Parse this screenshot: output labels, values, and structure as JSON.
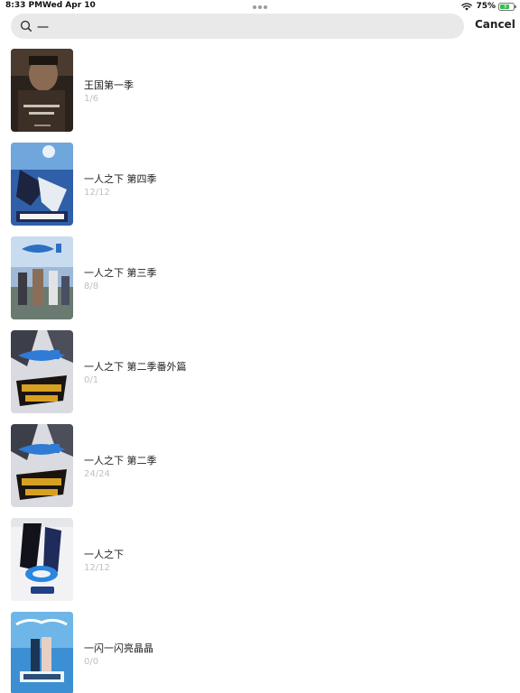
{
  "status_bar": {
    "time": "8:33 PM",
    "date": "Wed Apr 10",
    "battery_percent": "75%",
    "battery_level": 0.75,
    "wifi_icon": "wifi-icon",
    "battery_icon": "battery-charging-icon"
  },
  "search": {
    "value": "一",
    "icon": "search-icon"
  },
  "cancel_label": "Cancel",
  "results": [
    {
      "title": "王国第一季",
      "progress": "1/6"
    },
    {
      "title": "一人之下 第四季",
      "progress": "12/12"
    },
    {
      "title": "一人之下 第三季",
      "progress": "8/8"
    },
    {
      "title": "一人之下 第二季番外篇",
      "progress": "0/1"
    },
    {
      "title": "一人之下 第二季",
      "progress": "24/24"
    },
    {
      "title": "一人之下",
      "progress": "12/12"
    },
    {
      "title": "一闪一闪亮晶晶",
      "progress": "0/0"
    }
  ],
  "colors": {
    "search_bg": "#e9e9e9",
    "progress_text": "#c0c0c0",
    "battery_fill": "#2fbf4a"
  }
}
